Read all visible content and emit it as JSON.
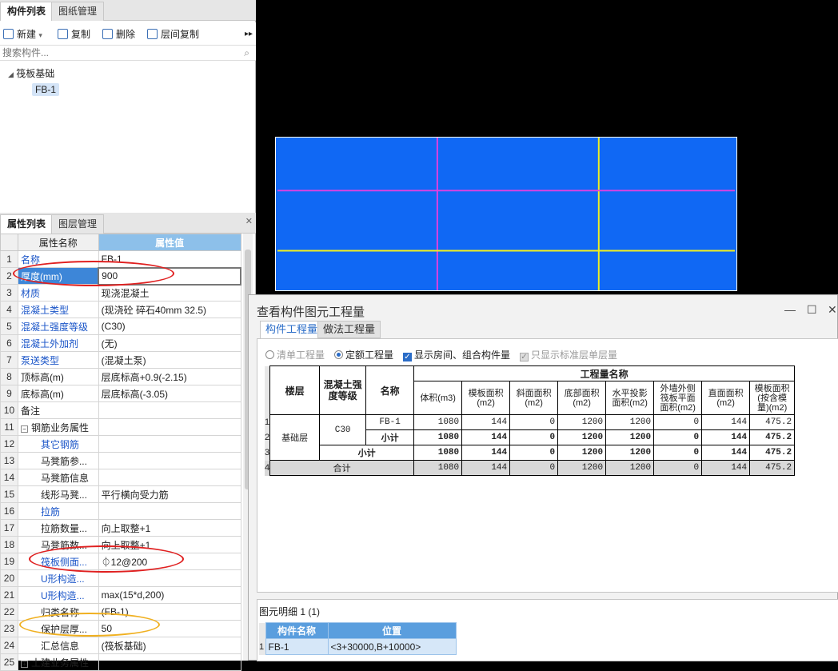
{
  "left_panel": {
    "tabs": [
      "构件列表",
      "图纸管理"
    ],
    "toolbar": {
      "new": "新建",
      "copy": "复制",
      "delete": "删除",
      "floor_copy": "层间复制"
    },
    "search_placeholder": "搜索构件...",
    "tree": {
      "root": "筏板基础",
      "child": "FB-1"
    }
  },
  "prop_panel": {
    "tabs": [
      "属性列表",
      "图层管理"
    ],
    "headers": [
      "属性名称",
      "属性值"
    ],
    "rows": [
      {
        "n": "1",
        "name": "名称",
        "value": "FB-1",
        "blue": true
      },
      {
        "n": "2",
        "name": "厚度(mm)",
        "value": "900",
        "blue": true
      },
      {
        "n": "3",
        "name": "材质",
        "value": "现浇混凝土",
        "blue": true
      },
      {
        "n": "4",
        "name": "混凝土类型",
        "value": "(现浇砼 碎石40mm 32.5)",
        "blue": true
      },
      {
        "n": "5",
        "name": "混凝土强度等级",
        "value": "(C30)",
        "blue": true
      },
      {
        "n": "6",
        "name": "混凝土外加剂",
        "value": "(无)",
        "blue": true
      },
      {
        "n": "7",
        "name": "泵送类型",
        "value": "(混凝土泵)",
        "blue": true
      },
      {
        "n": "8",
        "name": "顶标高(m)",
        "value": "层底标高+0.9(-2.15)",
        "blue": false
      },
      {
        "n": "9",
        "name": "底标高(m)",
        "value": "层底标高(-3.05)",
        "blue": false
      },
      {
        "n": "10",
        "name": "备注",
        "value": "",
        "blue": false
      },
      {
        "n": "11",
        "name": "钢筋业务属性",
        "value": "",
        "blue": false
      },
      {
        "n": "12",
        "name": "其它钢筋",
        "value": "",
        "blue": true
      },
      {
        "n": "13",
        "name": "马凳筋参...",
        "value": "",
        "blue": false
      },
      {
        "n": "14",
        "name": "马凳筋信息",
        "value": "",
        "blue": false
      },
      {
        "n": "15",
        "name": "线形马凳...",
        "value": "平行横向受力筋",
        "blue": false
      },
      {
        "n": "16",
        "name": "拉筋",
        "value": "",
        "blue": true
      },
      {
        "n": "17",
        "name": "拉筋数量...",
        "value": "向上取整+1",
        "blue": false
      },
      {
        "n": "18",
        "name": "马凳筋数...",
        "value": "向上取整+1",
        "blue": false
      },
      {
        "n": "19",
        "name": "筏板侧面...",
        "value": "⏀12@200",
        "blue": true
      },
      {
        "n": "20",
        "name": "U形构造...",
        "value": "",
        "blue": true
      },
      {
        "n": "21",
        "name": "U形构造...",
        "value": "max(15*d,200)",
        "blue": true
      },
      {
        "n": "22",
        "name": "归类名称",
        "value": "(FB-1)",
        "blue": false
      },
      {
        "n": "23",
        "name": "保护层厚...",
        "value": "50",
        "blue": false
      },
      {
        "n": "24",
        "name": "汇总信息",
        "value": "(筏板基础)",
        "blue": false
      },
      {
        "n": "25",
        "name": "土建业务属性",
        "value": "",
        "blue": false
      }
    ]
  },
  "dialog": {
    "title": "查看构件图元工程量",
    "tabs": [
      "构件工程量",
      "做法工程量"
    ],
    "options": [
      "清单工程量",
      "定额工程量",
      "显示房间、组合构件量",
      "只显示标准层单层量"
    ],
    "table": {
      "h_floor": "楼层",
      "h_grade": "混凝土强度等级",
      "h_name": "名称",
      "h_group": "工程量名称",
      "cols": [
        "体积(m3)",
        "模板面积(m2)",
        "斜面面积(m2)",
        "底部面积(m2)",
        "水平投影面积(m2)",
        "外墙外侧筏板平面面积(m2)",
        "直面面积(m2)",
        "模板面积(按含模量)(m2)"
      ],
      "floor": "基础层",
      "grade": "C30",
      "rows": [
        {
          "label": "FB-1",
          "values": [
            "1080",
            "144",
            "0",
            "1200",
            "1200",
            "0",
            "144",
            "475.2"
          ]
        },
        {
          "label": "小计",
          "values": [
            "1080",
            "144",
            "0",
            "1200",
            "1200",
            "0",
            "144",
            "475.2"
          ]
        },
        {
          "label": "小计",
          "values": [
            "1080",
            "144",
            "0",
            "1200",
            "1200",
            "0",
            "144",
            "475.2"
          ]
        },
        {
          "label": "合计",
          "values": [
            "1080",
            "144",
            "0",
            "1200",
            "1200",
            "0",
            "144",
            "475.2"
          ]
        }
      ]
    },
    "detail": {
      "label": "图元明细  1 (1)",
      "headers": [
        "构件名称",
        "位置"
      ],
      "row": {
        "name": "FB-1",
        "pos": "<3+30000,B+10000>"
      }
    }
  }
}
